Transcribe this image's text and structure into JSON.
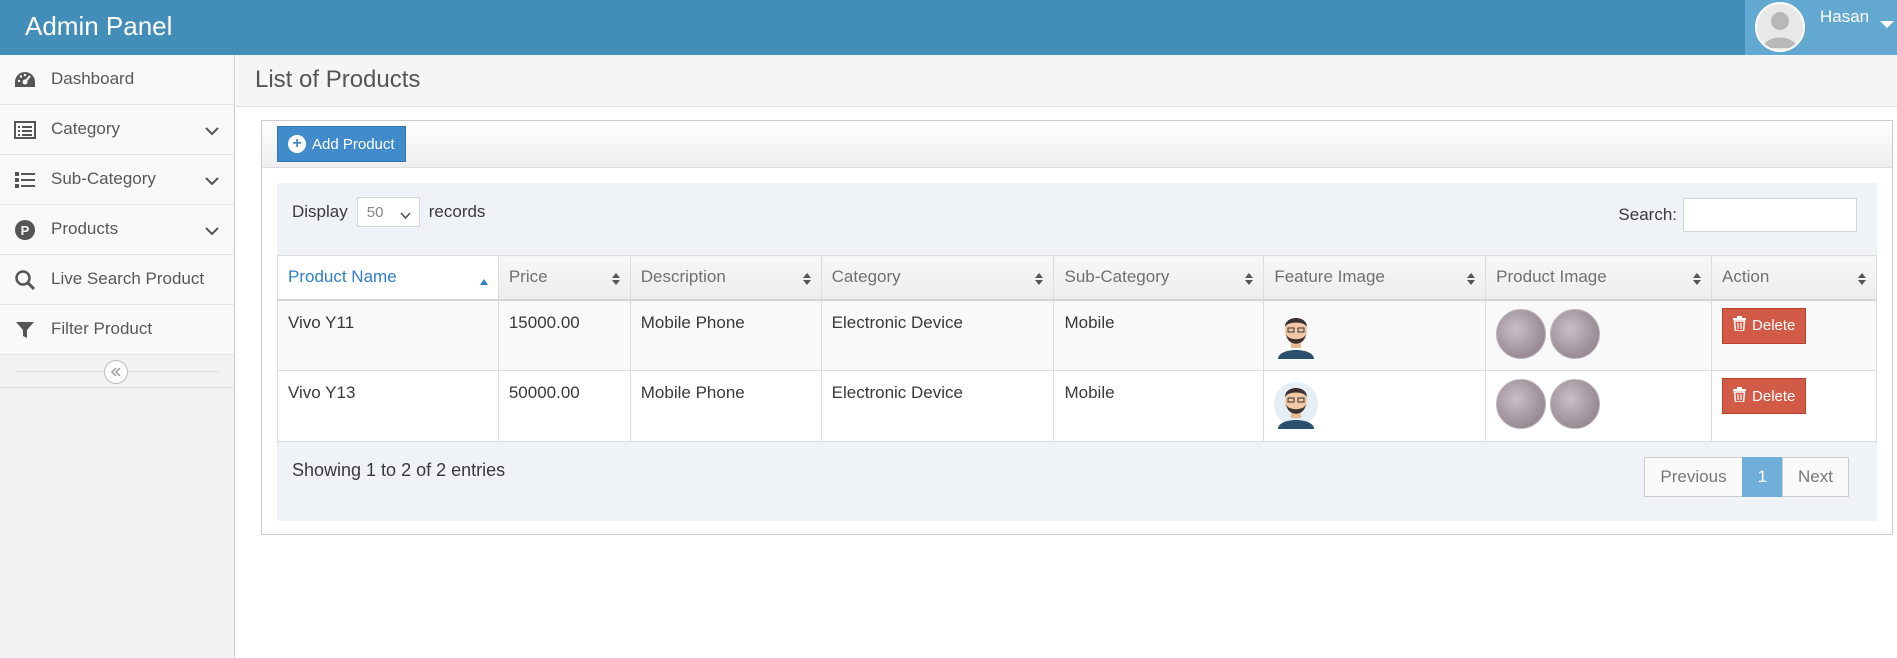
{
  "app": {
    "title": "Admin Panel"
  },
  "user": {
    "name": "Hasan"
  },
  "sidebar": {
    "items": [
      {
        "label": "Dashboard",
        "icon": "dashboard-icon",
        "has_submenu": false
      },
      {
        "label": "Category",
        "icon": "list-alt-icon",
        "has_submenu": true
      },
      {
        "label": "Sub-Category",
        "icon": "list-icon",
        "has_submenu": true
      },
      {
        "label": "Products",
        "icon": "product-p-icon",
        "has_submenu": true
      },
      {
        "label": "Live Search Product",
        "icon": "search-icon",
        "has_submenu": false
      },
      {
        "label": "Filter Product",
        "icon": "filter-icon",
        "has_submenu": false
      }
    ],
    "collapse_icon": "double-chevron-left-icon"
  },
  "page": {
    "title": "List of Products"
  },
  "toolbar": {
    "add_label": "Add Product"
  },
  "table_controls": {
    "display_label": "Display",
    "page_size": "50",
    "records_label": "records",
    "search_label": "Search:",
    "search_value": ""
  },
  "table": {
    "columns": [
      "Product Name",
      "Price",
      "Description",
      "Category",
      "Sub-Category",
      "Feature Image",
      "Product Image",
      "Action"
    ],
    "sorted_column": "Product Name",
    "sort_direction": "ascending",
    "rows": [
      {
        "name": "Vivo Y11",
        "price": "15000.00",
        "description": "Mobile Phone",
        "category": "Electronic Device",
        "sub_category": "Mobile",
        "action": "Delete"
      },
      {
        "name": "Vivo Y13",
        "price": "50000.00",
        "description": "Mobile Phone",
        "category": "Electronic Device",
        "sub_category": "Mobile",
        "action": "Delete"
      }
    ]
  },
  "footer": {
    "info": "Showing 1 to 2 of 2 entries",
    "previous": "Previous",
    "current_page": "1",
    "next": "Next"
  },
  "colors": {
    "navbar": "#438eb9",
    "user_box": "#62a8d1",
    "primary_button": "#428bca",
    "danger_button": "#d15b47",
    "active_page": "#6faed9"
  }
}
